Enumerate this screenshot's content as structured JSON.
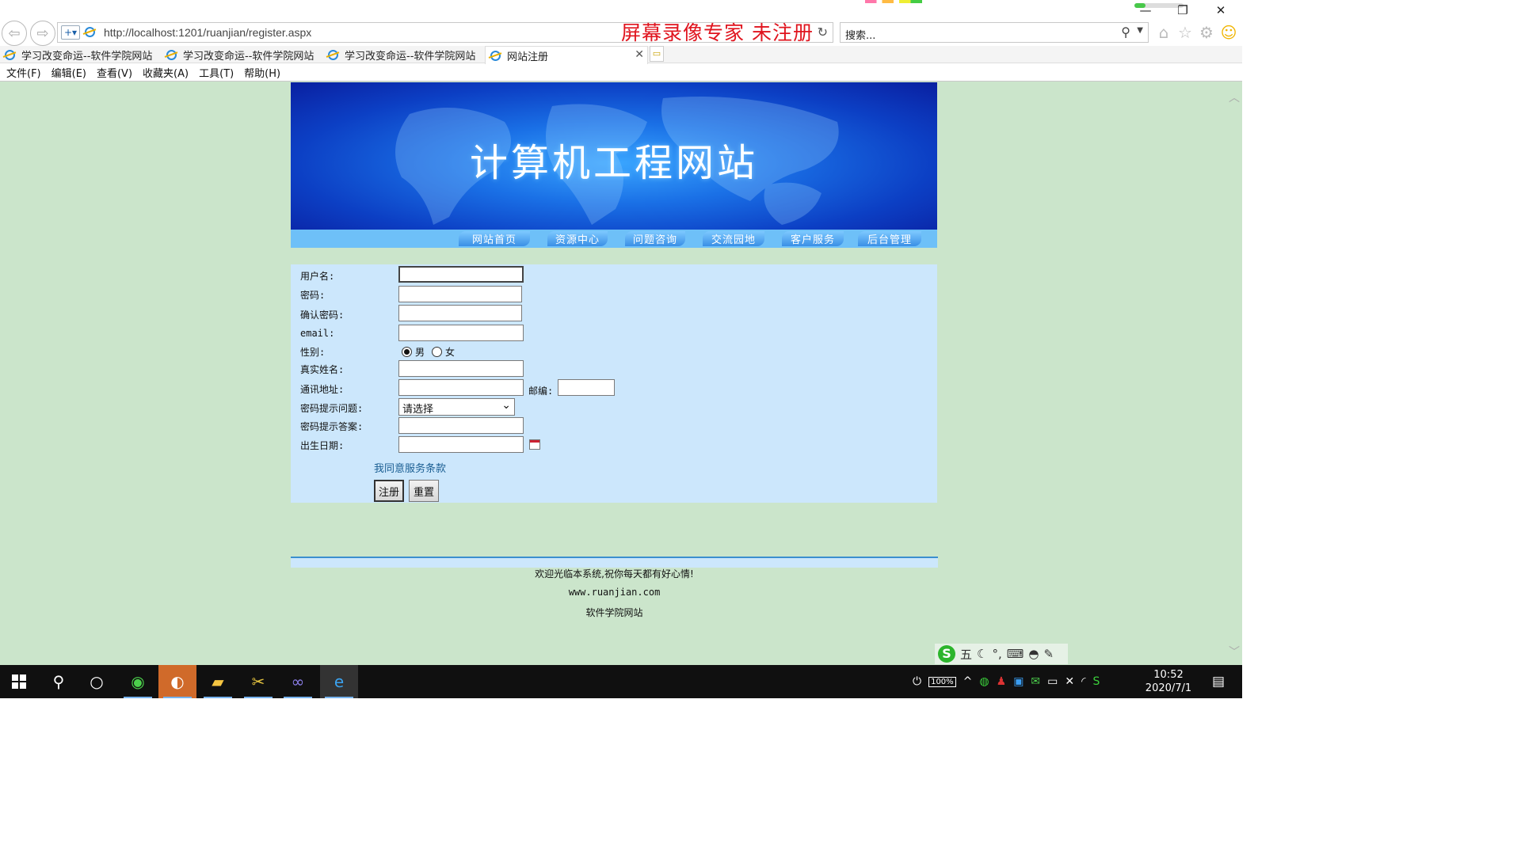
{
  "browser": {
    "url": "http://localhost:1201/ruanjian/register.aspx",
    "watermark": "屏幕录像专家 未注册",
    "search_placeholder": "搜索...",
    "tabs": [
      {
        "label": "学习改变命运--软件学院网站"
      },
      {
        "label": "学习改变命运--软件学院网站"
      },
      {
        "label": "学习改变命运--软件学院网站"
      },
      {
        "label": "网站注册",
        "active": true
      }
    ],
    "tab_close": "✕",
    "menu": [
      "文件(F)",
      "编辑(E)",
      "查看(V)",
      "收藏夹(A)",
      "工具(T)",
      "帮助(H)"
    ],
    "loading_progress": 0.22
  },
  "site": {
    "banner_title": "计算机工程网站",
    "nav": [
      "网站首页",
      "资源中心",
      "问题咨询",
      "交流园地",
      "客户服务",
      "后台管理"
    ]
  },
  "form": {
    "labels": {
      "username": "用户名:",
      "password": "密码:",
      "confirm_password": "确认密码:",
      "email": "email:",
      "gender": "性别:",
      "real_name": "真实姓名:",
      "address": "通讯地址:",
      "postcode": "邮编:",
      "question": "密码提示问题:",
      "answer": "密码提示答案:",
      "birthday": "出生日期:"
    },
    "gender_options": {
      "male": "男",
      "female": "女"
    },
    "gender_selected": "男",
    "question_selected": "请选择",
    "terms_link": "我同意服务条款",
    "register_button": "注册",
    "reset_button": "重置"
  },
  "footer": {
    "welcome": "欢迎光临本系统,祝你每天都有好心情!",
    "url": "www.ruanjian.com",
    "name": "软件学院网站"
  },
  "ime": {
    "mode": "五"
  },
  "taskbar": {
    "battery": "100%",
    "time": "10:52",
    "date": "2020/7/1"
  },
  "icons": {
    "back": "back-arrow-icon",
    "forward": "forward-arrow-icon",
    "home": "home-icon",
    "favorites": "star-icon",
    "settings": "gear-icon",
    "feedback": "smiley-icon"
  }
}
